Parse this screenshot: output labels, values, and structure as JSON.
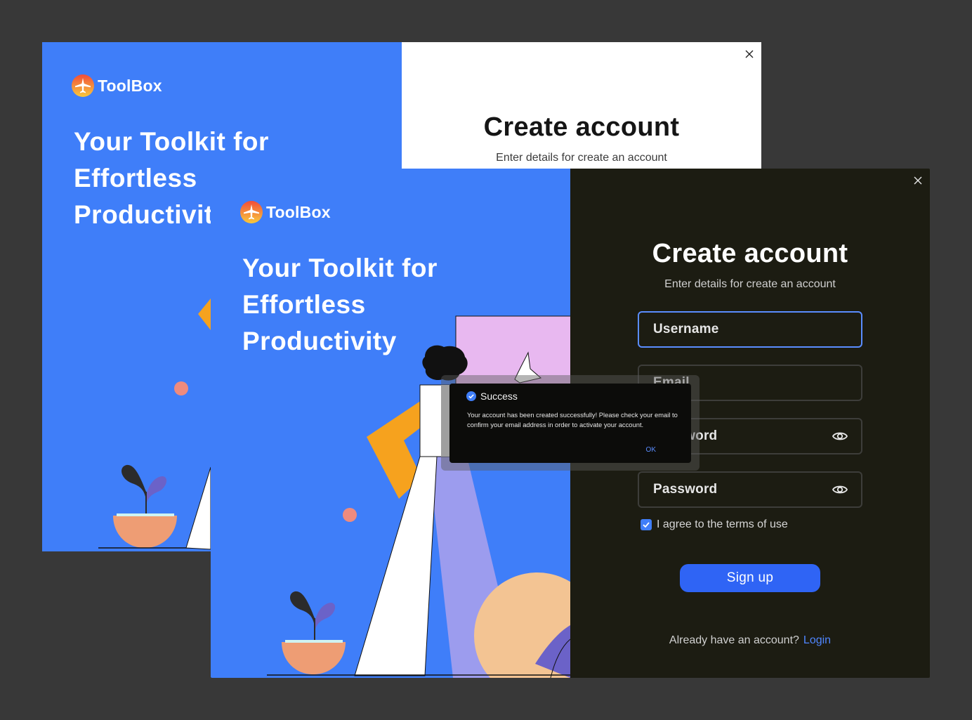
{
  "brand": {
    "name": "ToolBox",
    "logo_icon": "airplane-logo-icon"
  },
  "hero": {
    "lines": [
      "Your Toolkit for",
      "Effortless",
      "Productivity"
    ]
  },
  "back_window": {
    "title": "Create account",
    "subtitle": "Enter details for create an account"
  },
  "form": {
    "title": "Create account",
    "subtitle": "Enter details for create an account",
    "username": "Username",
    "email": "Email",
    "password": "Password",
    "confirm_password": "Password",
    "agree_label": "I agree to the terms of use",
    "agree_checked": true,
    "signup_label": "Sign up",
    "have_account": "Already have an account?",
    "login_label": "Login"
  },
  "dialog": {
    "title": "Success",
    "message": "Your account has been created successfully! Please check your email to confirm your email address in order to activate your account.",
    "ok_label": "OK"
  },
  "colors": {
    "background": "#383838",
    "hero_blue": "#3f7ef9",
    "dark_pane": "#1c1c12",
    "accent": "#2f64f5",
    "link": "#4f86ff"
  }
}
